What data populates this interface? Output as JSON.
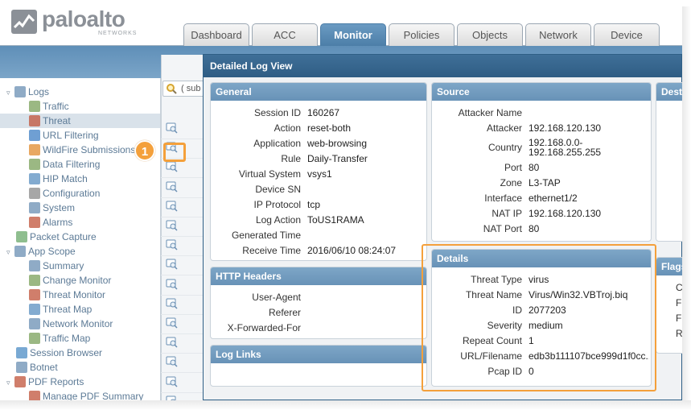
{
  "brand": {
    "name": "paloalto",
    "sub": "NETWORKS"
  },
  "tabs": [
    {
      "label": "Dashboard"
    },
    {
      "label": "ACC"
    },
    {
      "label": "Monitor",
      "active": true
    },
    {
      "label": "Policies"
    },
    {
      "label": "Objects"
    },
    {
      "label": "Network"
    },
    {
      "label": "Device"
    }
  ],
  "sidebar": {
    "items": [
      {
        "label": "Logs",
        "icon": "logs-icon",
        "expander": "▿"
      },
      {
        "label": "Traffic",
        "icon": "log-traffic-icon"
      },
      {
        "label": "Threat",
        "icon": "log-threat-icon",
        "selected": true
      },
      {
        "label": "URL Filtering",
        "icon": "url-filtering-icon"
      },
      {
        "label": "WildFire Submissions",
        "icon": "wildfire-icon"
      },
      {
        "label": "Data Filtering",
        "icon": "data-filtering-icon"
      },
      {
        "label": "HIP Match",
        "icon": "hip-match-icon"
      },
      {
        "label": "Configuration",
        "icon": "configuration-icon"
      },
      {
        "label": "System",
        "icon": "system-icon"
      },
      {
        "label": "Alarms",
        "icon": "alarms-icon"
      },
      {
        "label": "Packet Capture",
        "icon": "packet-capture-icon"
      },
      {
        "label": "App Scope",
        "icon": "app-scope-icon",
        "expander": "▿"
      },
      {
        "label": "Summary",
        "icon": "summary-icon"
      },
      {
        "label": "Change Monitor",
        "icon": "change-monitor-icon"
      },
      {
        "label": "Threat Monitor",
        "icon": "threat-monitor-icon"
      },
      {
        "label": "Threat Map",
        "icon": "threat-map-icon"
      },
      {
        "label": "Network Monitor",
        "icon": "network-monitor-icon"
      },
      {
        "label": "Traffic Map",
        "icon": "traffic-map-icon"
      },
      {
        "label": "Session Browser",
        "icon": "session-browser-icon"
      },
      {
        "label": "Botnet",
        "icon": "botnet-icon"
      },
      {
        "label": "PDF Reports",
        "icon": "pdf-reports-icon",
        "expander": "▿"
      },
      {
        "label": "Manage PDF Summary",
        "icon": "manage-pdf-icon"
      }
    ]
  },
  "search": {
    "placeholder": "( sub"
  },
  "callout": {
    "number": "1"
  },
  "dialog": {
    "title": "Detailed Log View",
    "general": {
      "header": "General",
      "rows": [
        {
          "k": "Session ID",
          "v": "160267"
        },
        {
          "k": "Action",
          "v": "reset-both"
        },
        {
          "k": "Application",
          "v": "web-browsing"
        },
        {
          "k": "Rule",
          "v": "Daily-Transfer"
        },
        {
          "k": "Virtual System",
          "v": "vsys1"
        },
        {
          "k": "Device SN",
          "v": ""
        },
        {
          "k": "IP Protocol",
          "v": "tcp"
        },
        {
          "k": "Log Action",
          "v": "ToUS1RAMA"
        },
        {
          "k": "Generated Time",
          "v": ""
        },
        {
          "k": "Receive Time",
          "v": "2016/06/10 08:24:07"
        }
      ]
    },
    "source": {
      "header": "Source",
      "rows": [
        {
          "k": "Attacker Name",
          "v": ""
        },
        {
          "k": "Attacker",
          "v": "192.168.120.130"
        },
        {
          "k": "Country",
          "v": "192.168.0.0-",
          "v2": "192.168.255.255"
        },
        {
          "k": "Port",
          "v": "80"
        },
        {
          "k": "Zone",
          "v": "L3-TAP"
        },
        {
          "k": "Interface",
          "v": "ethernet1/2"
        },
        {
          "k": "NAT IP",
          "v": "192.168.120.130"
        },
        {
          "k": "NAT Port",
          "v": "80"
        }
      ]
    },
    "destination": {
      "header": "Dest"
    },
    "http_headers": {
      "header": "HTTP Headers",
      "rows": [
        {
          "k": "User-Agent",
          "v": ""
        },
        {
          "k": "Referer",
          "v": ""
        },
        {
          "k": "X-Forwarded-For",
          "v": ""
        }
      ]
    },
    "log_links": {
      "header": "Log Links"
    },
    "details": {
      "header": "Details",
      "rows": [
        {
          "k": "Threat Type",
          "v": "virus"
        },
        {
          "k": "Threat Name",
          "v": "Virus/Win32.VBTroj.biq"
        },
        {
          "k": "ID",
          "v": "2077203"
        },
        {
          "k": "Severity",
          "v": "medium"
        },
        {
          "k": "Repeat Count",
          "v": "1"
        },
        {
          "k": "URL/Filename",
          "v": "edb3b111107bce999d1f0cc..."
        },
        {
          "k": "Pcap ID",
          "v": "0"
        }
      ]
    },
    "flags": {
      "header": "Flags",
      "letters": [
        "C",
        "F",
        "F",
        "R"
      ]
    }
  },
  "colors": {
    "accent": "#f4a03b",
    "header_blue": "#6892b7",
    "title_blue": "#2f5d84",
    "sidebar_text": "#5c7a96"
  }
}
